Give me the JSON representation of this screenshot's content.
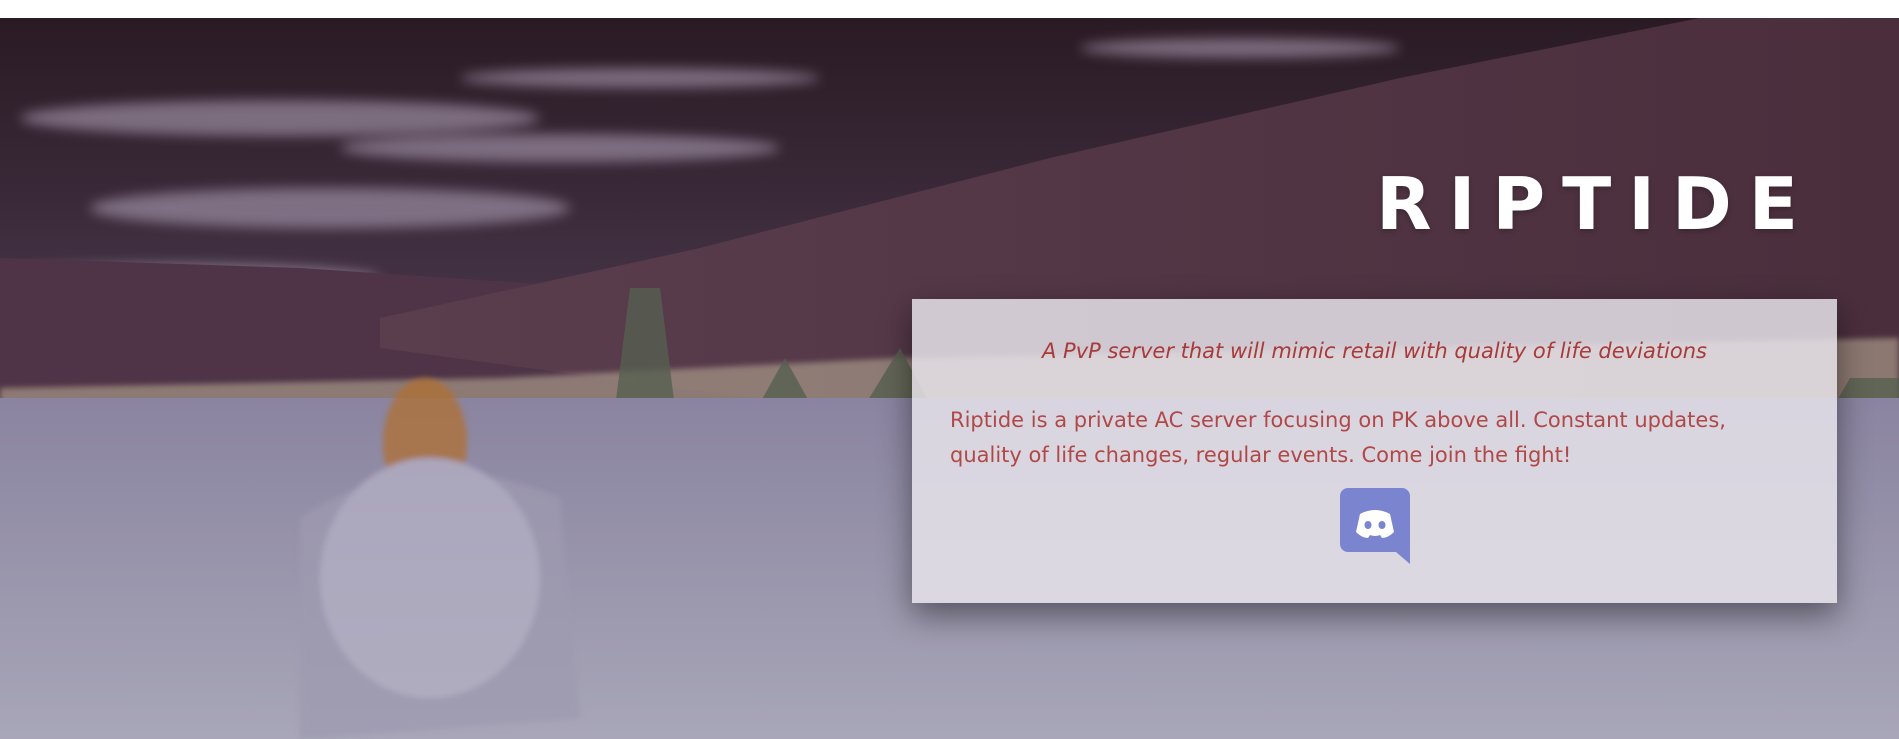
{
  "hero": {
    "title": "RIPTIDE"
  },
  "card": {
    "tagline": "A PvP server that will mimic retail with quality of life deviations",
    "description": "Riptide is a private AC server focusing on PK above all. Constant updates, quality of life changes, regular events. Come join the fight!",
    "discord_icon": "discord-icon"
  },
  "colors": {
    "title": "#ffffff",
    "text": "#b14848",
    "card_background": "#e8e5ec",
    "discord": "#7b84cf"
  }
}
